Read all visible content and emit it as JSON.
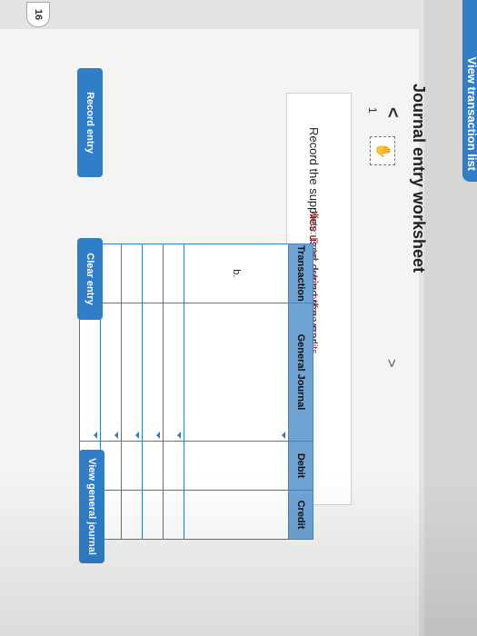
{
  "header": {
    "tab_label": "View transaction list",
    "question_number": "16"
  },
  "worksheet": {
    "title": "Journal entry worksheet",
    "nav_prev": "<",
    "nav_next": ">",
    "page_number": "1",
    "help_icon": "hand-icon",
    "instruction": "Record the supplies used during the year.",
    "note": "Note: Enter debits before credits."
  },
  "table": {
    "headers": [
      "Transaction",
      "General Journal",
      "Debit",
      "Credit"
    ],
    "rows": [
      [
        "b.",
        "",
        "",
        ""
      ],
      [
        "",
        "",
        "",
        ""
      ],
      [
        "",
        "",
        "",
        ""
      ],
      [
        "",
        "",
        "",
        ""
      ],
      [
        "",
        "",
        "",
        ""
      ],
      [
        "",
        "",
        "",
        ""
      ]
    ]
  },
  "buttons": {
    "record": "Record entry",
    "clear": "Clear entry",
    "view": "View general journal"
  },
  "colors": {
    "accent": "#2f7ec7",
    "header_bg": "#6ea3d4",
    "note": "#b22222"
  }
}
